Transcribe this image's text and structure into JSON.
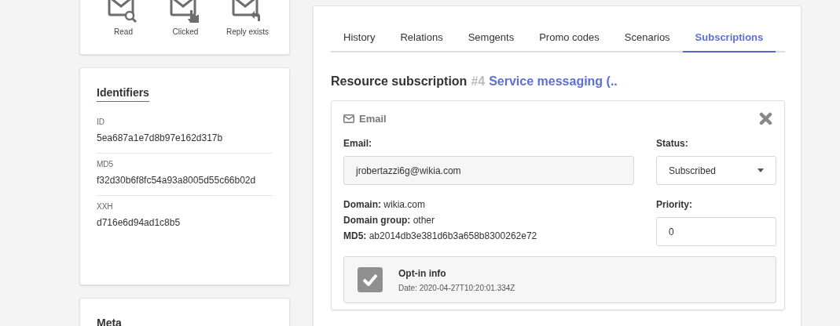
{
  "activity": [
    {
      "label": "Read",
      "kind": "read"
    },
    {
      "label": "Clicked",
      "kind": "clicked"
    },
    {
      "label": "Reply exists",
      "kind": "reply"
    }
  ],
  "identifiers": {
    "title": "Identifiers",
    "items": [
      {
        "label": "ID",
        "value": "5ea687a1e7d8b97e162d317b"
      },
      {
        "label": "MD5",
        "value": "f32d30b6f8fc54a93a8005d55c66b02d"
      },
      {
        "label": "XXH",
        "value": "d716e6d94ad1c8b5"
      }
    ]
  },
  "meta": {
    "title": "Meta"
  },
  "tabs": [
    {
      "label": "History",
      "selected": false
    },
    {
      "label": "Relations",
      "selected": false
    },
    {
      "label": "Semgents",
      "selected": false
    },
    {
      "label": "Promo codes",
      "selected": false
    },
    {
      "label": "Scenarios",
      "selected": false
    },
    {
      "label": "Subscriptions",
      "selected": true
    }
  ],
  "heading": {
    "title": "Resource subscription",
    "number": "#4",
    "name": "Service messaging (.."
  },
  "subscription": {
    "type": "Email",
    "email_label": "Email:",
    "email": "jrobertazzi6g@wikia.com",
    "status_label": "Status:",
    "status": "Subscribed",
    "details": [
      {
        "label": "Domain:",
        "value": "wikia.com"
      },
      {
        "label": "Domain group:",
        "value": "other"
      },
      {
        "label": "MD5:",
        "value": "ab2014db3e381d6b3a658b8300262e72"
      }
    ],
    "priority_label": "Priority:",
    "priority": "0",
    "opt_in": {
      "checked": true,
      "title": "Opt-in info",
      "date": "Date: 2020-04-27T10:20:01.334Z"
    }
  }
}
